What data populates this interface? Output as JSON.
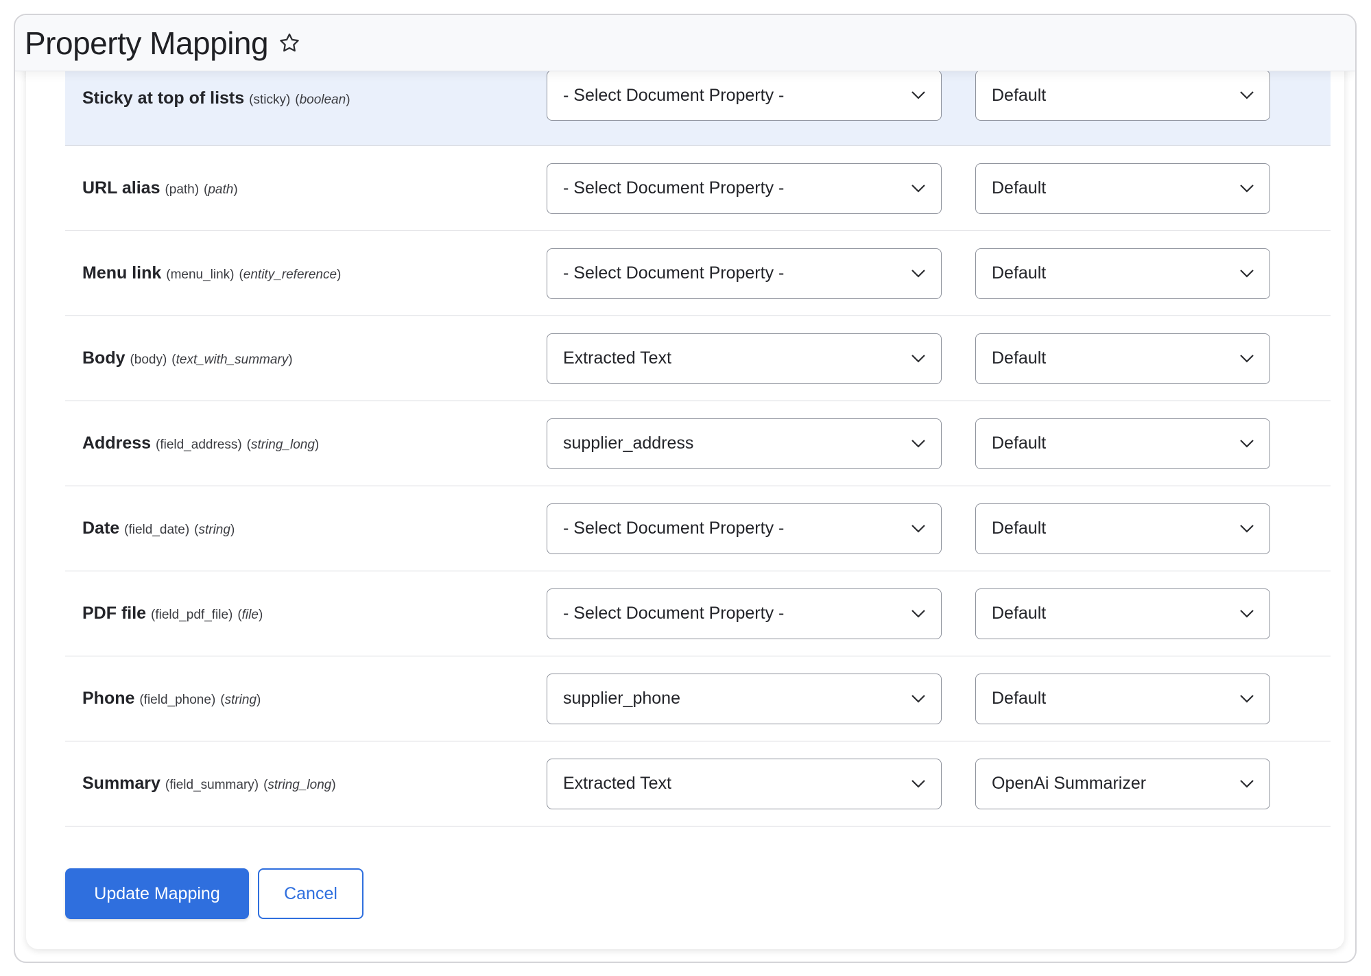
{
  "header": {
    "title": "Property Mapping",
    "favorite_icon": "star-icon"
  },
  "rows": [
    {
      "name": "Sticky at top of lists",
      "machine": "(sticky)",
      "type": "boolean",
      "property": "- Select Document Property -",
      "plugin": "Default",
      "highlighted": true
    },
    {
      "name": "URL alias",
      "machine": "(path)",
      "type": "path",
      "property": "- Select Document Property -",
      "plugin": "Default"
    },
    {
      "name": "Menu link",
      "machine": "(menu_link)",
      "type": "entity_reference",
      "property": "- Select Document Property -",
      "plugin": "Default"
    },
    {
      "name": "Body",
      "machine": "(body)",
      "type": "text_with_summary",
      "property": "Extracted Text",
      "plugin": "Default"
    },
    {
      "name": "Address",
      "machine": "(field_address)",
      "type": "string_long",
      "property": "supplier_address",
      "plugin": "Default"
    },
    {
      "name": "Date",
      "machine": "(field_date)",
      "type": "string",
      "property": "- Select Document Property -",
      "plugin": "Default"
    },
    {
      "name": "PDF file",
      "machine": "(field_pdf_file)",
      "type": "file",
      "property": "- Select Document Property -",
      "plugin": "Default"
    },
    {
      "name": "Phone",
      "machine": "(field_phone)",
      "type": "string",
      "property": "supplier_phone",
      "plugin": "Default"
    },
    {
      "name": "Summary",
      "machine": "(field_summary)",
      "type": "string_long",
      "property": "Extracted Text",
      "plugin": "OpenAi Summarizer"
    }
  ],
  "actions": {
    "update_label": "Update Mapping",
    "cancel_label": "Cancel"
  },
  "colors": {
    "primary": "#2f6fde",
    "highlight_row": "#eaf0fb",
    "border": "#8e929c"
  }
}
